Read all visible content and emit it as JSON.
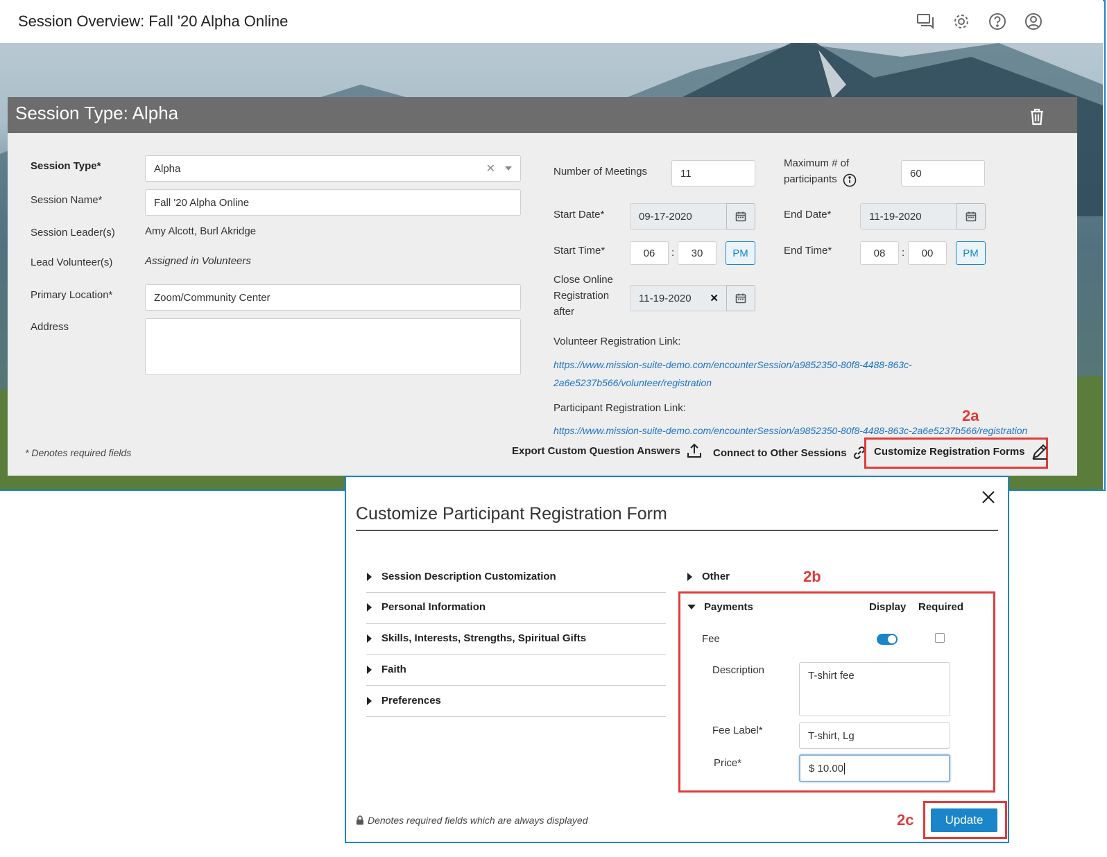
{
  "app": {
    "title": "Session Overview: Fall '20 Alpha Online",
    "icons": [
      "chat-icon",
      "gear-icon",
      "help-icon",
      "user-icon"
    ]
  },
  "card": {
    "title": "Session Type: Alpha",
    "left": {
      "session_type_label": "Session Type*",
      "session_type_value": "Alpha",
      "session_name_label": "Session Name*",
      "session_name_value": "Fall '20 Alpha Online",
      "leaders_label": "Session Leader(s)",
      "leaders_value": "Amy Alcott, Burl Akridge",
      "volunteers_label": "Lead Volunteer(s)",
      "volunteers_value": "Assigned in Volunteers",
      "location_label": "Primary Location*",
      "location_value": "Zoom/Community Center",
      "address_label": "Address",
      "address_value": ""
    },
    "right": {
      "meetings_label": "Number of Meetings",
      "meetings_value": "11",
      "max_label_1": "Maximum # of",
      "max_label_2": "participants",
      "max_value": "60",
      "start_date_label": "Start Date*",
      "start_date_value": "09-17-2020",
      "end_date_label": "End Date*",
      "end_date_value": "11-19-2020",
      "start_time_label": "Start Time*",
      "start_hour": "06",
      "start_min": "30",
      "start_ampm": "PM",
      "end_time_label": "End Time*",
      "end_hour": "08",
      "end_min": "00",
      "end_ampm": "PM",
      "time_sep": ":",
      "close_label_1": "Close Online",
      "close_label_2": "Registration",
      "close_label_3": "after",
      "close_value": "11-19-2020",
      "vol_link_label": "Volunteer Registration Link:",
      "vol_link_1": "https://www.mission-suite-demo.com/encounterSession/a9852350-80f8-4488-863c-",
      "vol_link_2": "2a6e5237b566/volunteer/registration",
      "part_link_label": "Participant Registration Link:",
      "part_link": "https://www.mission-suite-demo.com/encounterSession/a9852350-80f8-4488-863c-2a6e5237b566/registration"
    },
    "required_note": "* Denotes required fields",
    "actions": {
      "export": "Export Custom Question Answers",
      "connect": "Connect to Other Sessions",
      "customize": "Customize Registration Forms"
    }
  },
  "annotations": {
    "a": "2a",
    "b": "2b",
    "c": "2c"
  },
  "modal": {
    "title": "Customize Participant Registration Form",
    "sections_left": [
      "Session Description Customization",
      "Personal Information",
      "Skills, Interests, Strengths, Spiritual Gifts",
      "Faith",
      "Preferences"
    ],
    "other": "Other",
    "payments": {
      "title": "Payments",
      "display_col": "Display",
      "required_col": "Required",
      "fee_label": "Fee",
      "fee_display": true,
      "fee_required": false,
      "description_label": "Description",
      "description_value": "T-shirt fee",
      "fee_label_label": "Fee Label*",
      "fee_label_value": "T-shirt, Lg",
      "price_label": "Price*",
      "price_value": "$ 10.00"
    },
    "footer_note": "Denotes required fields which are always displayed",
    "update_label": "Update"
  }
}
